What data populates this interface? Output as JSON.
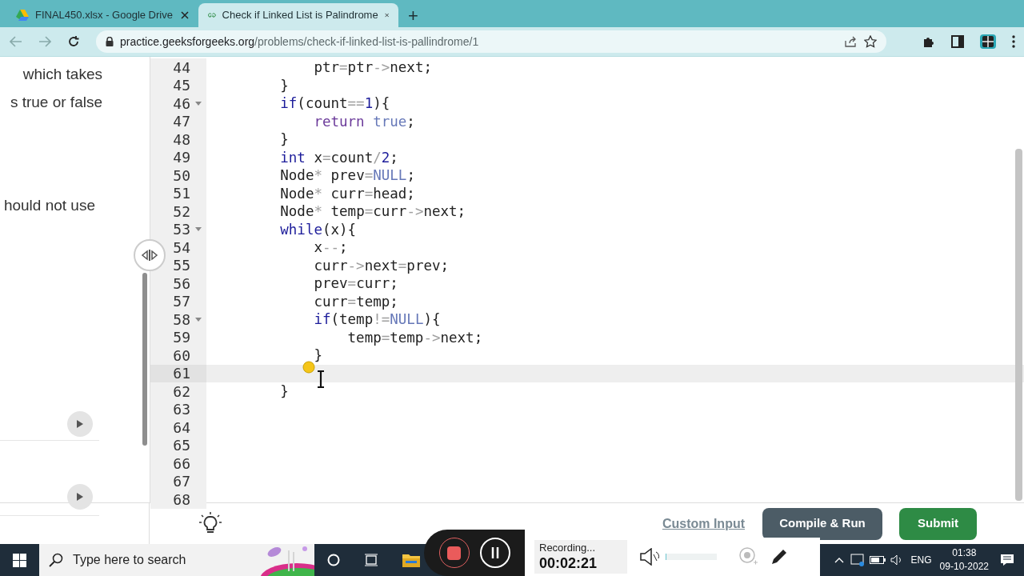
{
  "browser": {
    "tabs": [
      {
        "title": "FINAL450.xlsx - Google Drive",
        "selected": false
      },
      {
        "title": "Check if Linked List is Palindrome",
        "selected": true
      }
    ],
    "new_tab": "+",
    "url_host": "practice.geeksforgeeks.org",
    "url_path": "/problems/check-if-linked-list-is-pallindrome/1"
  },
  "problem_text": [
    "which takes",
    "s true or false",
    "hould not use"
  ],
  "editor": {
    "lines": [
      {
        "number": "44",
        "fold": false,
        "active": false,
        "tokens": [
          {
            "text": "            ptr",
            "kind": "plain"
          },
          {
            "text": "=",
            "kind": "op"
          },
          {
            "text": "ptr",
            "kind": "plain"
          },
          {
            "text": "->",
            "kind": "op"
          },
          {
            "text": "next;",
            "kind": "plain"
          }
        ]
      },
      {
        "number": "45",
        "fold": false,
        "active": false,
        "tokens": [
          {
            "text": "        }",
            "kind": "plain"
          }
        ]
      },
      {
        "number": "46",
        "fold": true,
        "active": false,
        "tokens": [
          {
            "text": "        if",
            "kind": "keyword"
          },
          {
            "text": "(count",
            "kind": "plain"
          },
          {
            "text": "==",
            "kind": "op"
          },
          {
            "text": "1",
            "kind": "number"
          },
          {
            "text": "){",
            "kind": "plain"
          }
        ]
      },
      {
        "number": "47",
        "fold": false,
        "active": false,
        "tokens": [
          {
            "text": "            return",
            "kind": "return"
          },
          {
            "text": " true",
            "kind": "constant"
          },
          {
            "text": ";",
            "kind": "plain"
          }
        ]
      },
      {
        "number": "48",
        "fold": false,
        "active": false,
        "tokens": [
          {
            "text": "        }",
            "kind": "plain"
          }
        ]
      },
      {
        "number": "49",
        "fold": false,
        "active": false,
        "tokens": [
          {
            "text": "        int",
            "kind": "keyword"
          },
          {
            "text": " x",
            "kind": "plain"
          },
          {
            "text": "=",
            "kind": "op"
          },
          {
            "text": "count",
            "kind": "plain"
          },
          {
            "text": "/",
            "kind": "op"
          },
          {
            "text": "2",
            "kind": "number"
          },
          {
            "text": ";",
            "kind": "plain"
          }
        ]
      },
      {
        "number": "50",
        "fold": false,
        "active": false,
        "tokens": [
          {
            "text": "        Node",
            "kind": "plain"
          },
          {
            "text": "*",
            "kind": "op"
          },
          {
            "text": " prev",
            "kind": "plain"
          },
          {
            "text": "=",
            "kind": "op"
          },
          {
            "text": "NULL",
            "kind": "constant"
          },
          {
            "text": ";",
            "kind": "plain"
          }
        ]
      },
      {
        "number": "51",
        "fold": false,
        "active": false,
        "tokens": [
          {
            "text": "        Node",
            "kind": "plain"
          },
          {
            "text": "*",
            "kind": "op"
          },
          {
            "text": " curr",
            "kind": "plain"
          },
          {
            "text": "=",
            "kind": "op"
          },
          {
            "text": "head;",
            "kind": "plain"
          }
        ]
      },
      {
        "number": "52",
        "fold": false,
        "active": false,
        "tokens": [
          {
            "text": "        Node",
            "kind": "plain"
          },
          {
            "text": "*",
            "kind": "op"
          },
          {
            "text": " temp",
            "kind": "plain"
          },
          {
            "text": "=",
            "kind": "op"
          },
          {
            "text": "curr",
            "kind": "plain"
          },
          {
            "text": "->",
            "kind": "op"
          },
          {
            "text": "next;",
            "kind": "plain"
          }
        ]
      },
      {
        "number": "53",
        "fold": true,
        "active": false,
        "tokens": [
          {
            "text": "        while",
            "kind": "keyword"
          },
          {
            "text": "(x){",
            "kind": "plain"
          }
        ]
      },
      {
        "number": "54",
        "fold": false,
        "active": false,
        "tokens": [
          {
            "text": "            x",
            "kind": "plain"
          },
          {
            "text": "--",
            "kind": "op"
          },
          {
            "text": ";",
            "kind": "plain"
          }
        ]
      },
      {
        "number": "55",
        "fold": false,
        "active": false,
        "tokens": [
          {
            "text": "            curr",
            "kind": "plain"
          },
          {
            "text": "->",
            "kind": "op"
          },
          {
            "text": "next",
            "kind": "plain"
          },
          {
            "text": "=",
            "kind": "op"
          },
          {
            "text": "prev;",
            "kind": "plain"
          }
        ]
      },
      {
        "number": "56",
        "fold": false,
        "active": false,
        "tokens": [
          {
            "text": "            prev",
            "kind": "plain"
          },
          {
            "text": "=",
            "kind": "op"
          },
          {
            "text": "curr;",
            "kind": "plain"
          }
        ]
      },
      {
        "number": "57",
        "fold": false,
        "active": false,
        "tokens": [
          {
            "text": "            curr",
            "kind": "plain"
          },
          {
            "text": "=",
            "kind": "op"
          },
          {
            "text": "temp;",
            "kind": "plain"
          }
        ]
      },
      {
        "number": "58",
        "fold": true,
        "active": false,
        "tokens": [
          {
            "text": "            if",
            "kind": "keyword"
          },
          {
            "text": "(temp",
            "kind": "plain"
          },
          {
            "text": "!=",
            "kind": "op"
          },
          {
            "text": "NULL",
            "kind": "constant"
          },
          {
            "text": "){",
            "kind": "plain"
          }
        ]
      },
      {
        "number": "59",
        "fold": false,
        "active": false,
        "tokens": [
          {
            "text": "                temp",
            "kind": "plain"
          },
          {
            "text": "=",
            "kind": "op"
          },
          {
            "text": "temp",
            "kind": "plain"
          },
          {
            "text": "->",
            "kind": "op"
          },
          {
            "text": "next;",
            "kind": "plain"
          }
        ]
      },
      {
        "number": "60",
        "fold": false,
        "active": false,
        "tokens": [
          {
            "text": "            }",
            "kind": "plain"
          }
        ]
      },
      {
        "number": "61",
        "fold": false,
        "active": true
      },
      {
        "number": "62",
        "fold": false,
        "active": false,
        "tokens": [
          {
            "text": "        }",
            "kind": "plain"
          }
        ]
      },
      {
        "number": "63",
        "fold": false,
        "active": false
      },
      {
        "number": "64",
        "fold": false,
        "active": false
      },
      {
        "number": "65",
        "fold": false,
        "active": false
      },
      {
        "number": "66",
        "fold": false,
        "active": false
      },
      {
        "number": "67",
        "fold": false,
        "active": false
      },
      {
        "number": "68",
        "fold": false,
        "active": false
      }
    ]
  },
  "actions": {
    "custom_input": "Custom Input",
    "compile": "Compile & Run",
    "submit": "Submit"
  },
  "recorder": {
    "status": "Recording...",
    "time": "00:02:21",
    "level": 0.02
  },
  "taskbar": {
    "search_placeholder": "Type here to search",
    "language": "ENG",
    "time": "01:38",
    "date": "09-10-2022"
  }
}
